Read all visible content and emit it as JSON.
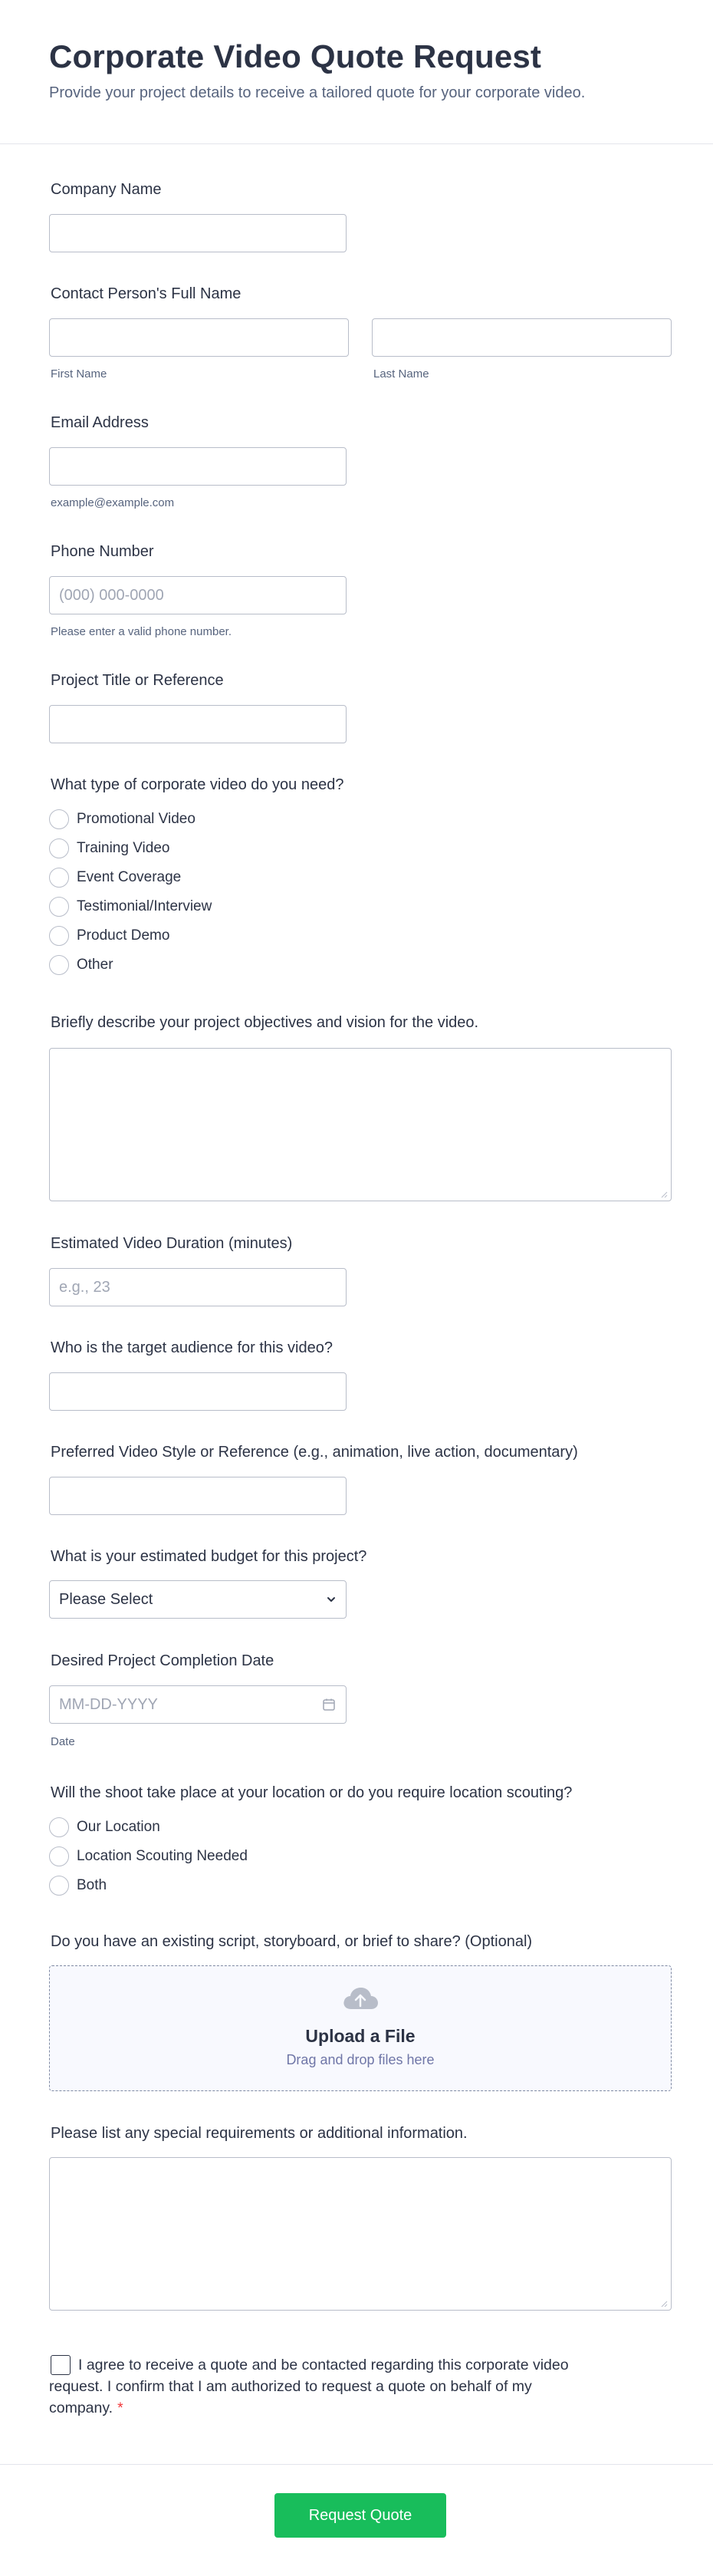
{
  "header": {
    "title": "Corporate Video Quote Request",
    "subtitle": "Provide your project details to receive a tailored quote for your corporate video."
  },
  "fields": {
    "company_name": {
      "label": "Company Name",
      "value": ""
    },
    "contact_name": {
      "label": "Contact Person's Full Name",
      "first_sublabel": "First Name",
      "last_sublabel": "Last Name"
    },
    "email": {
      "label": "Email Address",
      "sublabel": "example@example.com"
    },
    "phone": {
      "label": "Phone Number",
      "placeholder": "(000) 000-0000",
      "sublabel": "Please enter a valid phone number."
    },
    "project_title": {
      "label": "Project Title or Reference"
    },
    "video_type": {
      "label": "What type of corporate video do you need?",
      "options": [
        "Promotional Video",
        "Training Video",
        "Event Coverage",
        "Testimonial/Interview",
        "Product Demo",
        "Other"
      ]
    },
    "objectives": {
      "label": "Briefly describe your project objectives and vision for the video."
    },
    "duration": {
      "label": "Estimated Video Duration (minutes)",
      "placeholder": "e.g., 23"
    },
    "audience": {
      "label": "Who is the target audience for this video?"
    },
    "style": {
      "label": "Preferred Video Style or Reference (e.g., animation, live action, documentary)"
    },
    "budget": {
      "label": "What is your estimated budget for this project?",
      "selected": "Please Select"
    },
    "completion_date": {
      "label": "Desired Project Completion Date",
      "placeholder": "MM-DD-YYYY",
      "sublabel": "Date"
    },
    "location": {
      "label": "Will the shoot take place at your location or do you require location scouting?",
      "options": [
        "Our Location",
        "Location Scouting Needed",
        "Both"
      ]
    },
    "script_upload": {
      "label": "Do you have an existing script, storyboard, or brief to share? (Optional)",
      "title": "Upload a File",
      "subtitle": "Drag and drop files here"
    },
    "special_requirements": {
      "label": "Please list any special requirements or additional information."
    },
    "consent": {
      "text": "I agree to receive a quote and be contacted regarding this corporate video request. I confirm that I am authorized to request a quote on behalf of my company.",
      "required_mark": "*"
    }
  },
  "submit": {
    "label": "Request Quote"
  },
  "colors": {
    "primary_text": "#2c3345",
    "secondary_text": "#57647e",
    "border": "#b8bdc9",
    "submit_bg": "#18bd5b",
    "required": "#f23a3c"
  },
  "icons": {
    "chevron": "chevron-down-icon",
    "calendar": "calendar-icon",
    "upload": "cloud-upload-icon"
  }
}
